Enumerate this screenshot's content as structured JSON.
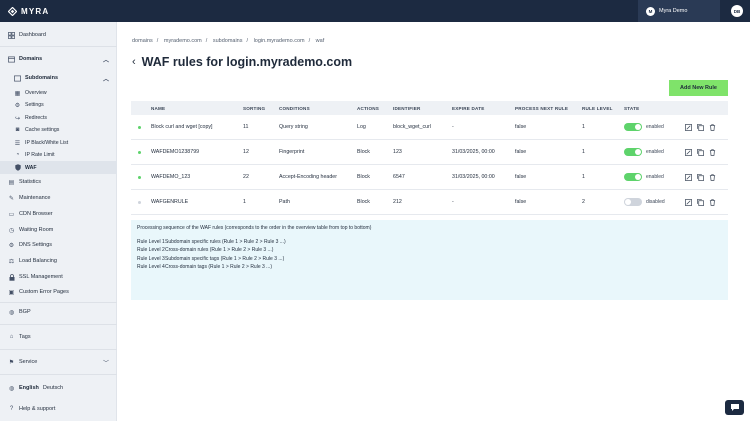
{
  "brand": {
    "name": "MYRA"
  },
  "user": {
    "name": "Myra Demo",
    "avatar_initial": "M",
    "badge": "DB"
  },
  "sidebar": {
    "dashboard": "Dashboard",
    "domains": "Domains",
    "subdomains": "Subdomains",
    "sub_items": [
      "Overview",
      "Settings",
      "Redirects",
      "Cache settings",
      "IP Black/White List",
      "IP Rate Limit",
      "WAF"
    ],
    "domain_items": [
      "Statistics",
      "Maintenance",
      "CDN Browser",
      "Waiting Room",
      "DNS Settings",
      "Load Balancing",
      "SSL Management",
      "Custom Error Pages"
    ],
    "bgp": "BGP",
    "tags": "Tags",
    "service": "Service",
    "lang_active": "English",
    "lang_other": "Deutsch",
    "help": "Help & support"
  },
  "breadcrumb": [
    "domains",
    "myrademo.com",
    "subdomains",
    "login.myrademo.com",
    "waf"
  ],
  "page": {
    "title": "WAF rules for login.myrademo.com",
    "add_button": "Add New Rule"
  },
  "table": {
    "headers": [
      "NAME",
      "SORTING",
      "CONDITIONS",
      "ACTIONS",
      "IDENTIFIER",
      "EXPIRE DATE",
      "PROCESS NEXT RULE",
      "RULE LEVEL",
      "STATE"
    ],
    "rows": [
      {
        "name": "Block curl and wget [copy]",
        "sorting": "11",
        "conditions": "Query string",
        "actions": "Log",
        "identifier": "block_wget_curl",
        "expire": "-",
        "process_next": "false",
        "level": "1",
        "state": "enabled",
        "on": true
      },
      {
        "name": "WAFDEMO1238799",
        "sorting": "12",
        "conditions": "Fingerprint",
        "actions": "Block",
        "identifier": "123",
        "expire": "31/03/2025, 00:00",
        "process_next": "false",
        "level": "1",
        "state": "enabled",
        "on": true
      },
      {
        "name": "WAFDEMO_123",
        "sorting": "22",
        "conditions": "Accept-Encoding header",
        "actions": "Block",
        "identifier": "6547",
        "expire": "31/03/2025, 00:00",
        "process_next": "false",
        "level": "1",
        "state": "enabled",
        "on": true
      },
      {
        "name": "WAFGENRULE",
        "sorting": "1",
        "conditions": "Path",
        "actions": "Block",
        "identifier": "212",
        "expire": "-",
        "process_next": "false",
        "level": "2",
        "state": "disabled",
        "on": false
      }
    ]
  },
  "info": {
    "heading": "Processing sequence of the WAF rules (corresponds to the order in the overview table from top to bottom)",
    "levels": [
      {
        "key": "Rule Level 1",
        "text": "Subdomain specific rules (Rule 1 > Rule 2 > Rule 3 ...)"
      },
      {
        "key": "Rule Level 2",
        "text": "Cross-domain rules (Rule 1 > Rule 2 > Rule 3 ...)"
      },
      {
        "key": "Rule Level 3",
        "text": "Subdomain specific tags (Rule 1 > Rule 2 > Rule 3 ...)"
      },
      {
        "key": "Rule Level 4",
        "text": "Cross-domain tags (Rule 1 > Rule 2 > Rule 3 ...)"
      }
    ]
  },
  "colors": {
    "topbar": "#1c2a41",
    "accent_green": "#7fe36a",
    "toggle_on": "#5ed36b",
    "toggle_off": "#cfd4dc",
    "info_bg": "#e9f7fb"
  }
}
